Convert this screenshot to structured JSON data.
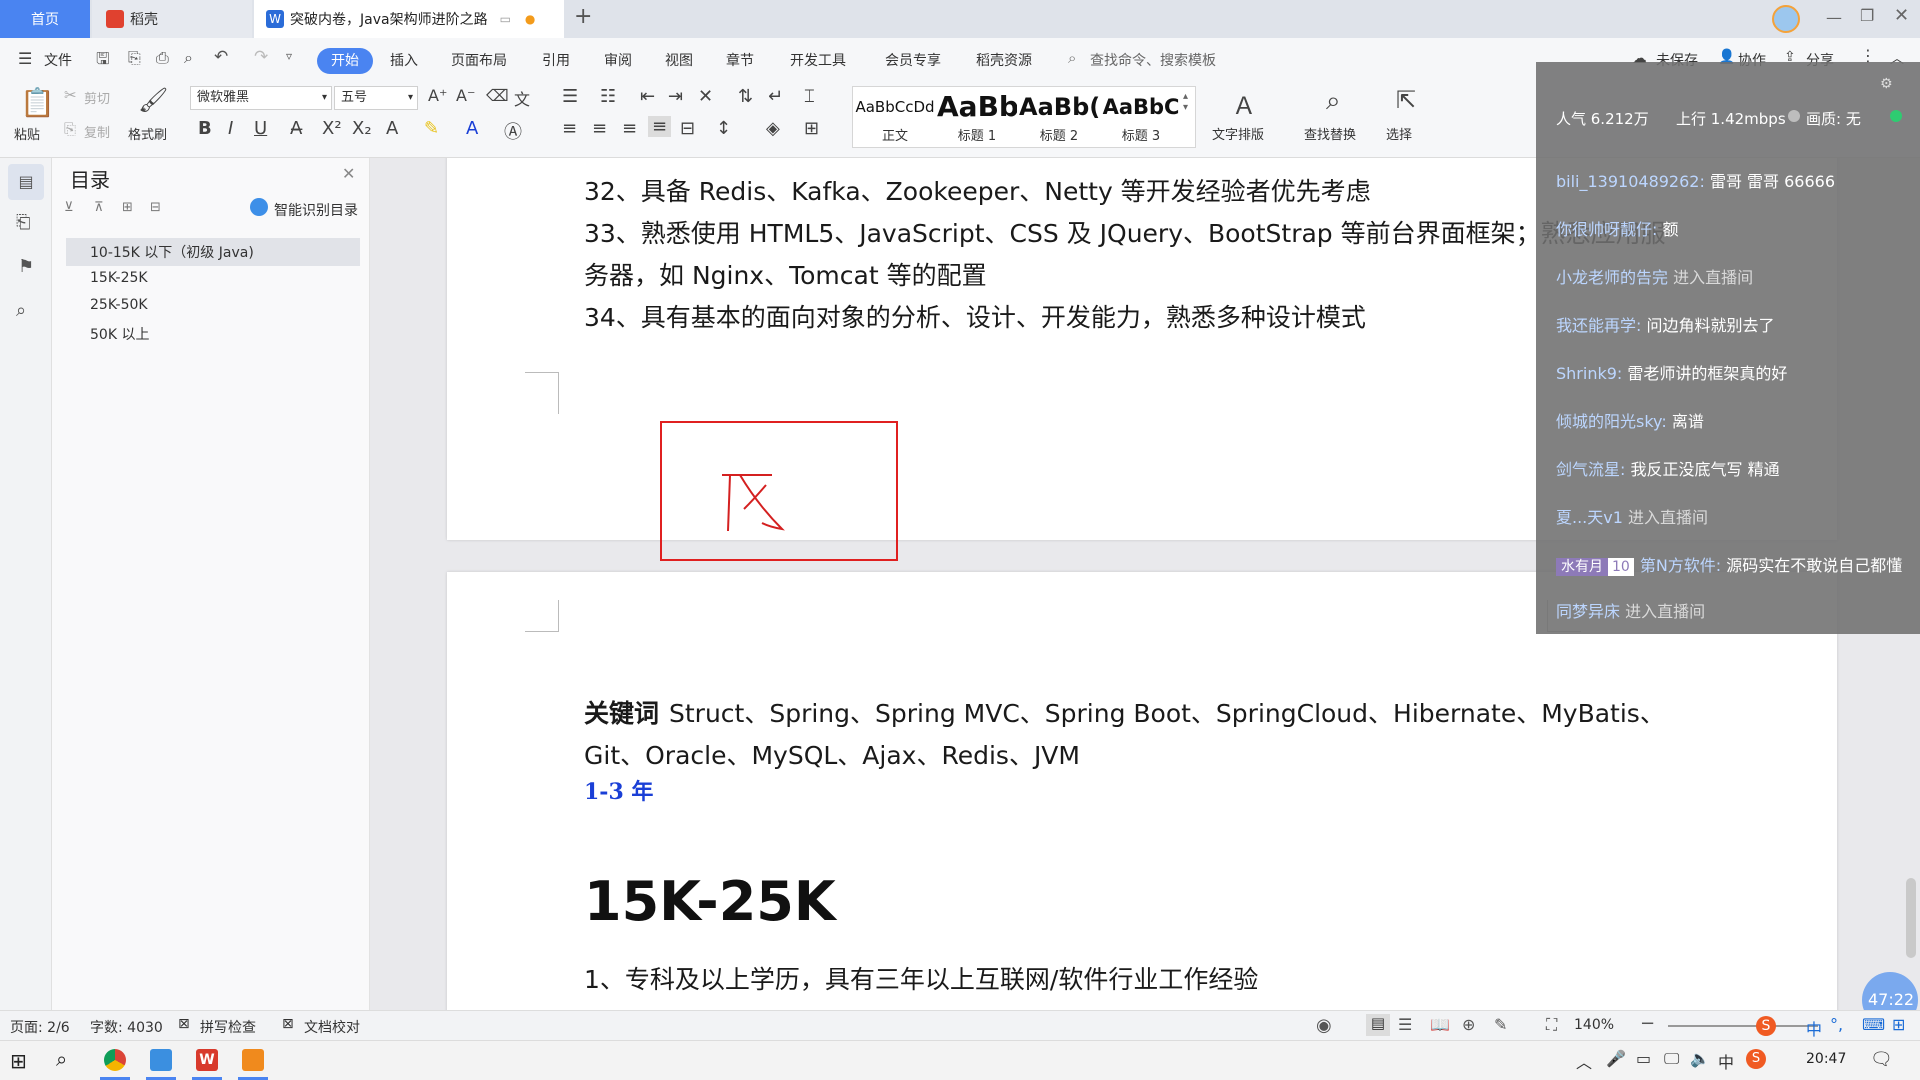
{
  "tabs": {
    "home": "首页",
    "daoke": "稻壳",
    "doc": "突破内卷，Java架构师进阶之路",
    "new_tab": "+"
  },
  "menu": {
    "file": "文件",
    "start": "开始",
    "insert": "插入",
    "layout": "页面布局",
    "reference": "引用",
    "review": "审阅",
    "view": "视图",
    "chapter": "章节",
    "devtools": "开发工具",
    "member": "会员专享",
    "resources": "稻壳资源",
    "search_placeholder": "查找命令、搜索模板",
    "unsaved": "未保存",
    "collab": "协作",
    "share": "分享"
  },
  "ribbon": {
    "paste": "粘贴",
    "cut": "剪切",
    "copy": "复制",
    "format_painter": "格式刷",
    "font_name": "微软雅黑",
    "font_size": "五号",
    "style_normal_sample": "AaBbCcDd",
    "style_normal": "正文",
    "style_h1_sample": "AaBb",
    "style_h1": "标题 1",
    "style_h2_sample": "AaBb(",
    "style_h2": "标题 2",
    "style_h3_sample": "AaBbC",
    "style_h3": "标题 3",
    "text_layout": "文字排版",
    "find_replace": "查找替换",
    "select": "选择"
  },
  "nav": {
    "title": "目录",
    "smart": "智能识别目录",
    "items": [
      "10-15K 以下（初级 Java)",
      "15K-25K",
      "25K-50K",
      "50K 以上"
    ]
  },
  "doc": {
    "line32": "32、具备 Redis、Kafka、Zookeeper、Netty 等开发经验者优先考虑",
    "line33a": "33、熟悉使用 HTML5、JavaScript、CSS 及 JQuery、BootStrap 等前台界面框架；熟悉应用服",
    "line33b": "务器，如 Nginx、Tomcat 等的配置",
    "line34": "34、具有基本的面向对象的分析、设计、开发能力，熟悉多种设计模式",
    "keywords_label": "关键词",
    "keywords_a": "Struct、Spring、Spring MVC、Spring Boot、SpringCloud、Hibernate、MyBatis、",
    "keywords_b": "Git、Oracle、MySQL、Ajax、Redis、JVM",
    "years": "1-3 年",
    "heading": "15K-25K",
    "line1": "1、专科及以上学历，具有三年以上互联网/软件行业工作经验"
  },
  "overlay": {
    "stats": [
      "人气  6.212万",
      "上行  1.42mbps",
      "画质: 无"
    ],
    "chat": [
      {
        "user": "bili_13910489262:",
        "msg": "雷哥  雷哥  66666"
      },
      {
        "user": "你很帅呀靓仔:",
        "msg": "额"
      },
      {
        "user": "小龙老师的告完",
        "msg": "进入直播间",
        "enter": true
      },
      {
        "user": "我还能再学:",
        "msg": "问边角料就别去了"
      },
      {
        "user": "Shrink9:",
        "msg": "雷老师讲的框架真的好"
      },
      {
        "user": "倾城的阳光sky:",
        "msg": "离谱"
      },
      {
        "user": "剑气流星:",
        "msg": "我反正没底气写 精通"
      },
      {
        "user": "夏...天v1",
        "msg": "进入直播间",
        "enter": true
      },
      {
        "user": "第N方软件:",
        "msg": "源码实在不敢说自己都懂",
        "badge": "水有月",
        "level": "10"
      },
      {
        "user": "同梦异床",
        "msg": "进入直播间",
        "enter": true
      }
    ]
  },
  "status": {
    "page": "页面: 2/6",
    "words": "字数: 4030",
    "spell": "拼写检查",
    "proof": "文档校对",
    "zoom": "140%",
    "timer": "47:22",
    "ime": "中"
  },
  "taskbar": {
    "clock": "20:47"
  },
  "colors": {
    "accent": "#4a84f1",
    "years_blue": "#1a3fd6",
    "annotation_red": "#e02020"
  }
}
